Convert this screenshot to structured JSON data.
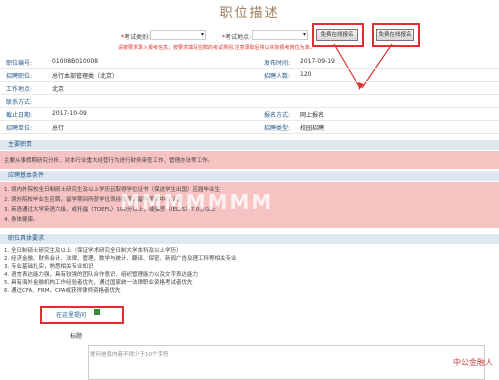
{
  "page": {
    "title": "职位描述"
  },
  "filter": {
    "exam_type_label": "考试类别:",
    "exam_place_label": "考试地点:",
    "warning": "请按要求录入报考信息；按要求填写应聘的考试类别,注意录取后将以实际报考岗位为准。",
    "search_btn": "免费在线报名",
    "apply_btn": "免费在线报名"
  },
  "info": {
    "job_no_label": "职位编号:",
    "job_no": "01008B010008",
    "pub_time_label": "发布时间:",
    "pub_time": "2017-09-19",
    "unit_label": "招聘职位:",
    "unit": "总行本部管理类（北京）",
    "count_label": "招聘人数:",
    "count": "120",
    "work_place_label": "工作地点:",
    "work_place": "北京",
    "contact_label": "联系方式:",
    "contact": "",
    "deadline_label": "截止日期:",
    "deadline": "2017-10-09",
    "apply_method_label": "报名方式:",
    "apply_method": "网上报名",
    "dept_label": "招聘单位:",
    "dept": "总行",
    "type_label": "招聘类型:",
    "type": "校园招聘"
  },
  "sections": {
    "duty": "主要职责",
    "requirement": "应聘基本条件",
    "specific": "职位具体要求"
  },
  "content": {
    "duty_text": "主要从事假期研究分析、对本行业重大经营行为进行财务审查工作、管理办法等工作。",
    "req_text": "1. 境内外院校全日制硕士研究生及以上学历且取得学位证书（保送学生出国）应届毕业生",
    "req_text2": "2. 境外院校毕业生应聘，留学期间所获学位须经教育部留学服务中心认证",
    "req_text3": "3. 英语通过大学英语六级，或托福（TOEFL）100分以上，或雅思（IELTS）7.0分以上",
    "req_text4": "4. 身体健康。",
    "spec_items": [
      "1. 全日制硕士研究生及以上（保证学术研究全日制大学本科及以上学历）",
      "2. 经济金融、财务会计、法律、管理、数学与统计、翻译、保密、新闻广告及理工科等相关专业",
      "3. 专业基础扎实，熟悉相关专业知识",
      "4. 语言表达能力强，具有较强的团队合作意识、组织管理能力以及文字表达能力",
      "5. 具有海外金融机构工作经验者优先，通过国家统一法律职业资格考试者优先",
      "6. 通过CFA、FRM、CPA或获得律师资格者优先"
    ]
  },
  "qa": {
    "label": "在这里提问",
    "field_label": "标题",
    "hint": "提问信息内容不得少于10个字符"
  },
  "watermark": "中公金融人",
  "overlay": "MMMMMMM"
}
